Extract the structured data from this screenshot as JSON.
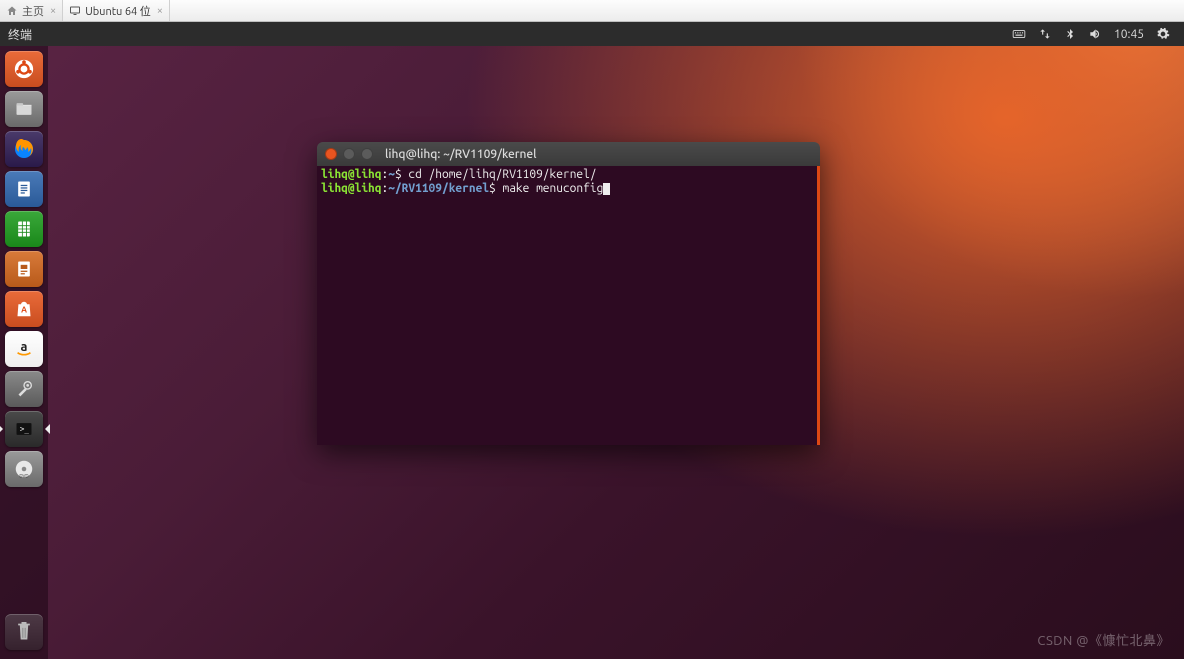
{
  "vm_tabs": {
    "home": "主页",
    "active": "Ubuntu 64 位"
  },
  "menubar": {
    "app": "终端",
    "clock": "10:45"
  },
  "launcher": {
    "dash": "dash",
    "files": "files",
    "firefox": "firefox",
    "writer": "libreoffice-writer",
    "calc": "libreoffice-calc",
    "impress": "libreoffice-impress",
    "software": "ubuntu-software",
    "amazon": "amazon",
    "settings": "system-settings",
    "terminal": "terminal",
    "disc": "disc",
    "trash": "trash"
  },
  "terminal": {
    "title": "lihq@lihq: ~/RV1109/kernel",
    "line1": {
      "user": "lihq@lihq",
      "path": "~",
      "sep": ":",
      "prompt": "$",
      "cmd": " cd /home/lihq/RV1109/kernel/"
    },
    "line2": {
      "user": "lihq@lihq",
      "path": "~/RV1109/kernel",
      "sep": ":",
      "prompt": "$",
      "cmd": " make menuconfig"
    }
  },
  "watermark": "CSDN @《慷忙北鼻》"
}
